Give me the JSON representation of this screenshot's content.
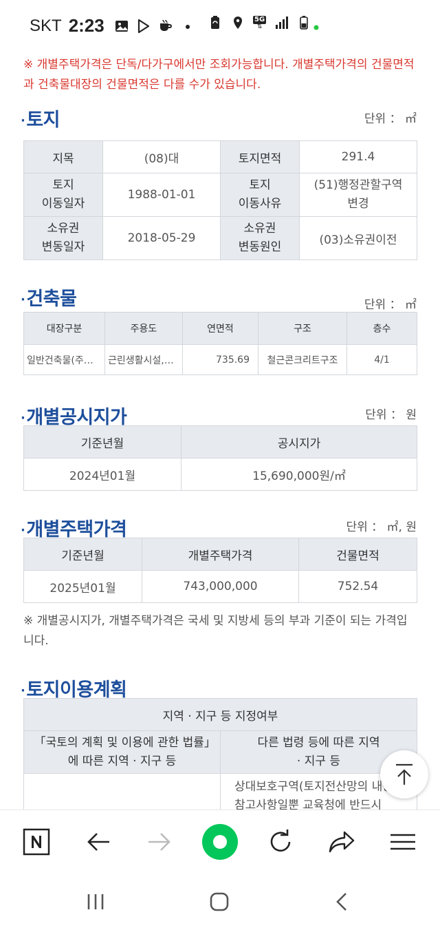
{
  "status_bar": {
    "carrier": "SKT",
    "time": "2:23",
    "network": "5G"
  },
  "notice_top": "※ 개별주택가격은 단독/다가구에서만 조회가능합니다. 개별주택가격의 건물면적과 건축물대장의 건물면적은 다를 수가 있습니다.",
  "land": {
    "title": "토지",
    "unit": "단위 ： ㎡",
    "rows": [
      {
        "h1": "지목",
        "v1": "(08)대",
        "h2": "토지면적",
        "v2": "291.4"
      },
      {
        "h1": "토지\n이동일자",
        "v1": "1988-01-01",
        "h2": "토지\n이동사유",
        "v2": "(51)행정관할구역\n변경"
      },
      {
        "h1": "소유권\n변동일자",
        "v1": "2018-05-29",
        "h2": "소유권\n변동원인",
        "v2": "(03)소유권이전"
      }
    ]
  },
  "building": {
    "title": "건축물",
    "unit": "단위 ： ㎡",
    "headers": [
      "대장구분",
      "주용도",
      "연면적",
      "구조",
      "층수"
    ],
    "row": [
      "일반건축물(주…",
      "근린생활시설,…",
      "735.69",
      "철근콘크리트구조",
      "4/1"
    ]
  },
  "land_price": {
    "title": "개별공시지가",
    "unit": "단위 ： 원",
    "headers": [
      "기준년월",
      "공시지가"
    ],
    "row": [
      "2024년01월",
      "15,690,000원/㎡"
    ]
  },
  "house_price": {
    "title": "개별주택가격",
    "unit": "단위 ： ㎡, 원",
    "headers": [
      "기준년월",
      "개별주택가격",
      "건물면적"
    ],
    "row": [
      "2025년01월",
      "743,000,000",
      "752.54"
    ]
  },
  "notice_tax": "※ 개별공시지가, 개별주택가격은 국세 및 지방세 등의 부과 기준이 되는 가격입니다.",
  "land_use": {
    "title": "토지이용계획",
    "header_main": "지역 · 지구 등 지정여부",
    "sub_left": "「국토의 계획 및 이용에 관한 법률」에 따른 지역 · 지구 등",
    "sub_right": "다른 법령 등에 따른 지역 · 지구 등",
    "cell_right": "상대보호구역(토지전산망의 내용은 참고사항일뿐 교육청에 반드시"
  },
  "icons": {
    "scroll_top": "arrow-up-to-top-icon",
    "toolbar": [
      "naver-n-icon",
      "back-arrow-icon",
      "forward-arrow-icon",
      "green-dot-icon",
      "refresh-icon",
      "share-icon",
      "menu-icon"
    ],
    "nav": [
      "recent-apps-icon",
      "home-icon",
      "back-icon"
    ]
  },
  "colors": {
    "accent_title": "#1e4f9c",
    "notice_red": "#d9382f",
    "header_bg": "#e7ebf0",
    "green": "#03c75a"
  }
}
